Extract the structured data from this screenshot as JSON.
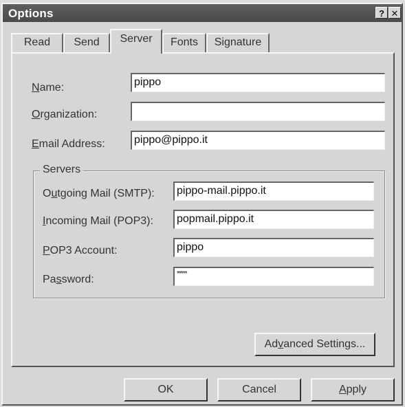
{
  "window": {
    "title": "Options",
    "help_glyph": "?",
    "close_glyph": "✕"
  },
  "tabs": [
    {
      "label": "Read",
      "active": false
    },
    {
      "label": "Send",
      "active": false
    },
    {
      "label": "Server",
      "active": true
    },
    {
      "label": "Fonts",
      "active": false
    },
    {
      "label": "Signature",
      "active": false
    }
  ],
  "server": {
    "name_label": {
      "hot": "N",
      "rest": "ame:"
    },
    "name_value": "pippo",
    "org_label": {
      "hot": "O",
      "rest": "rganization:"
    },
    "org_value": "",
    "email_label": {
      "hot": "E",
      "rest": "mail Address:"
    },
    "email_value": "pippo@pippo.it",
    "group_title": "Servers",
    "smtp_label": {
      "pre": "O",
      "hot": "u",
      "rest": "tgoing Mail (SMTP):"
    },
    "smtp_value": "pippo-mail.pippo.it",
    "pop3_label": {
      "hot": "I",
      "rest": "ncoming Mail (POP3):"
    },
    "pop3_value": "popmail.pippo.it",
    "account_label": {
      "hot": "P",
      "rest": "OP3 Account:"
    },
    "account_value": "pippo",
    "password_label": {
      "pre": "Pa",
      "hot": "s",
      "rest": "sword:"
    },
    "password_value": "*****",
    "advanced": {
      "pre": "Ad",
      "hot": "v",
      "rest": "anced Settings..."
    }
  },
  "buttons": {
    "ok": "OK",
    "cancel": "Cancel",
    "apply": {
      "hot": "A",
      "rest": "pply"
    }
  }
}
